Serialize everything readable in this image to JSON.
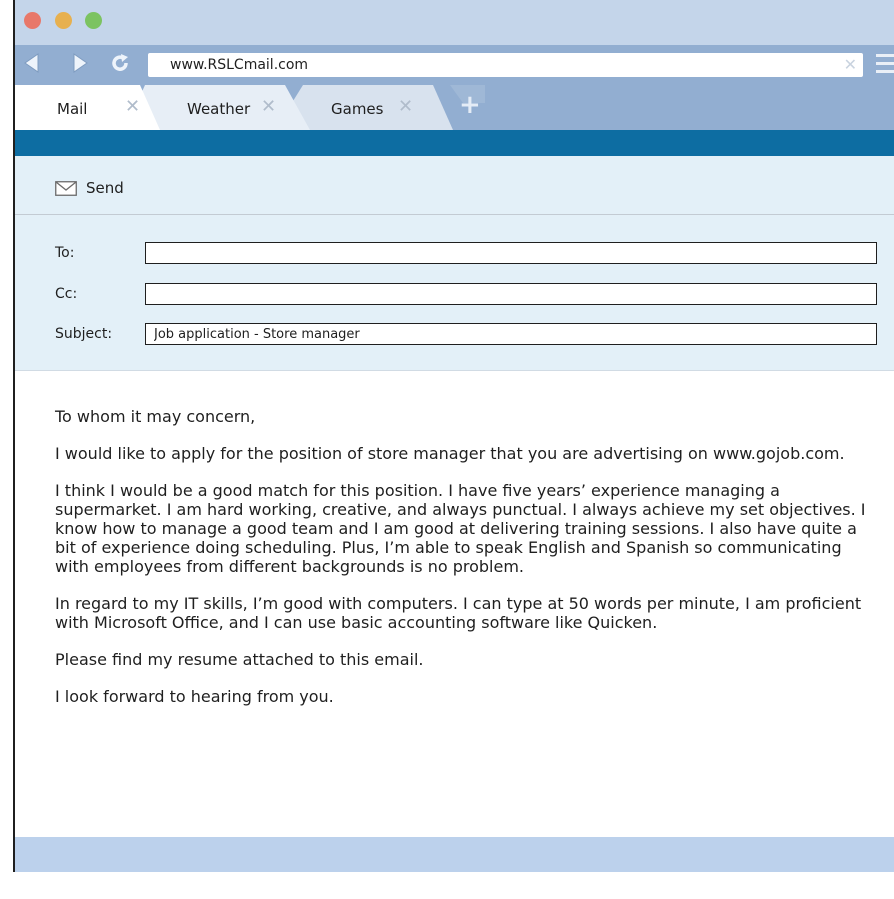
{
  "browser": {
    "url": "www.RSLCmail.com",
    "tabs": [
      {
        "label": "Mail"
      },
      {
        "label": "Weather"
      },
      {
        "label": "Games"
      }
    ]
  },
  "toolbar": {
    "send_label": "Send"
  },
  "fields": {
    "to_label": "To:",
    "to_value": "",
    "cc_label": "Cc:",
    "cc_value": "",
    "subject_label": "Subject:",
    "subject_value": "Job application - Store manager"
  },
  "message": {
    "paragraphs": [
      "To whom it may concern,",
      "I would like to apply for the position of store manager that you are advertising on www.gojob.com.",
      "I think I would be a good match for this position. I have five years’ experience managing a supermarket. I am hard working, creative, and always punctual. I always achieve my set objectives. I know how to manage a good team and I am good at delivering training sessions. I also have quite a bit of experience doing scheduling. Plus, I’m able to speak English and Spanish so communicating with employees from different backgrounds is no problem.",
      "In regard to my IT skills, I’m good with computers. I can type at 50 words per minute, I am proficient with Microsoft Office, and I can use basic accounting software like Quicken.",
      "Please find my resume attached to this email.",
      "I look forward to hearing from you."
    ]
  },
  "icons": {
    "back": "back-arrow-icon",
    "forward": "forward-arrow-icon",
    "reload": "reload-icon",
    "clear": "clear-icon",
    "menu": "menu-icon",
    "tab_close": "close-icon",
    "new_tab": "plus-icon",
    "send": "envelope-icon"
  },
  "colors": {
    "accent_band": "#0d6da2",
    "compose_bg": "#e3f0f8",
    "titlebar_bg": "#c4d5ea",
    "navbar_bg": "#92aed1"
  }
}
